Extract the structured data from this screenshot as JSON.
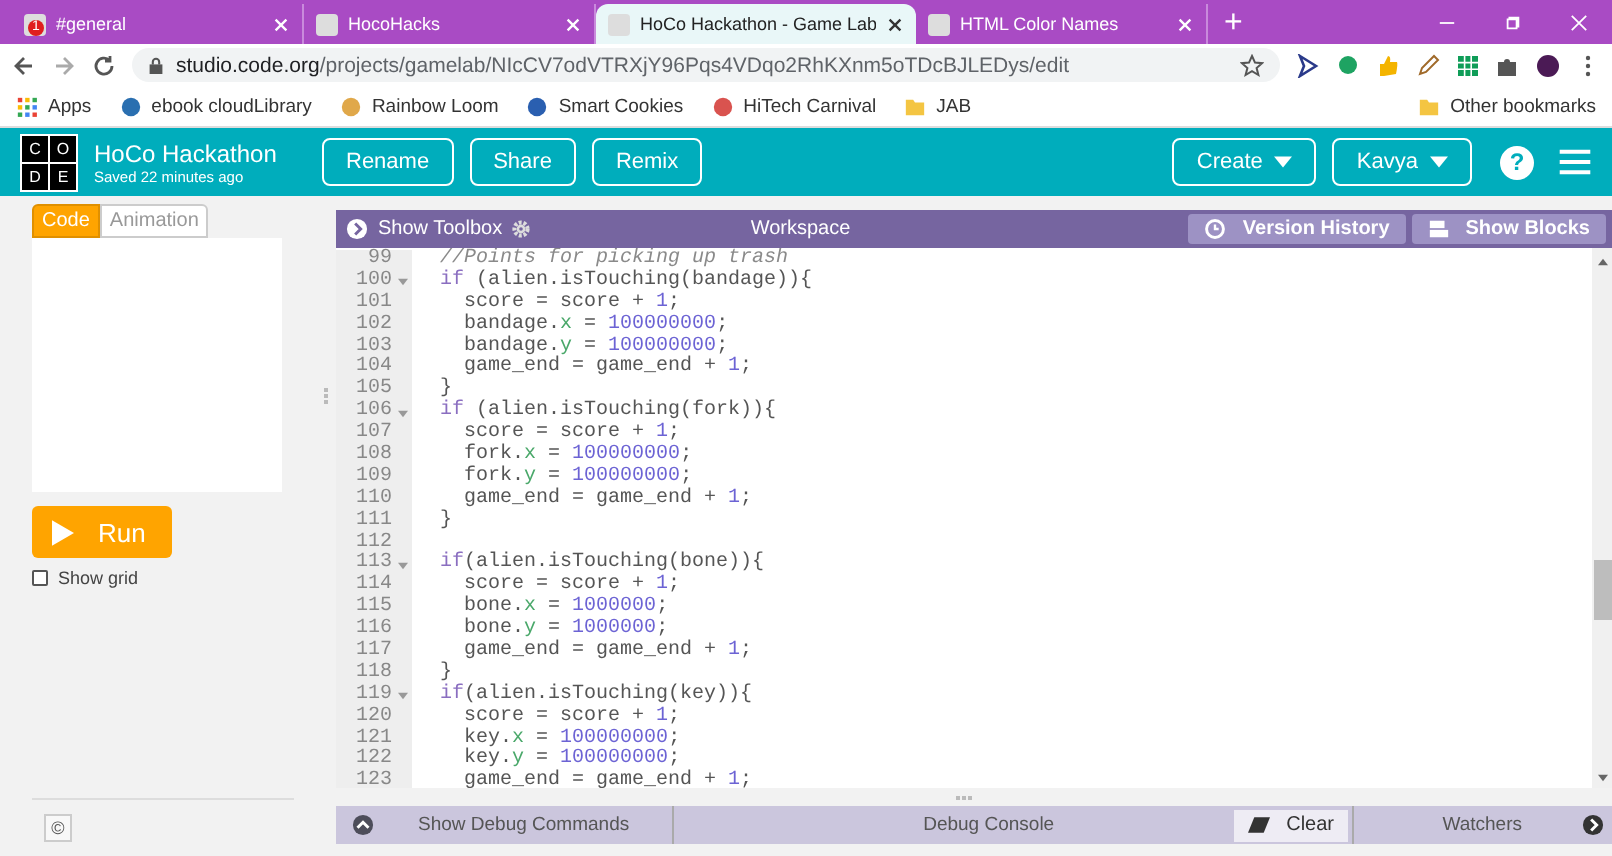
{
  "browser": {
    "tabs": [
      {
        "title": "#general",
        "selected": false,
        "badge": "1"
      },
      {
        "title": "HocoHacks",
        "selected": false
      },
      {
        "title": "HoCo Hackathon - Game Lab",
        "selected": true
      },
      {
        "title": "HTML Color Names",
        "selected": false
      }
    ],
    "new_tab": "+",
    "url_host": "studio.code.org",
    "url_path": "/projects/gamelab/NIcCV7odVTRXjY96Pqs4VDqo2RhKXnm5oTDcBJLEDys/edit",
    "bookmarks": [
      "Apps",
      "ebook cloudLibrary",
      "Rainbow Loom",
      "Smart Cookies",
      "HiTech Carnival",
      "JAB"
    ],
    "other_bookmarks": "Other bookmarks"
  },
  "header": {
    "logo": [
      "C",
      "O",
      "D",
      "E"
    ],
    "title": "HoCo Hackathon",
    "saved": "Saved 22 minutes ago",
    "buttons": [
      "Rename",
      "Share",
      "Remix"
    ],
    "create": "Create",
    "user": "Kavya",
    "help": "?"
  },
  "left": {
    "tabs": [
      {
        "label": "Code",
        "selected": true
      },
      {
        "label": "Animation",
        "selected": false
      }
    ],
    "run": "Run",
    "show_grid": {
      "label": "Show grid",
      "checked": false
    },
    "copyright": "©"
  },
  "workspace": {
    "toolbox": "Show Toolbox",
    "title": "Workspace",
    "version_history": "Version History",
    "show_blocks": "Show Blocks",
    "lines": [
      {
        "n": "99",
        "fold": false,
        "code": [
          {
            "kind": "comment",
            "text": "//Points for picking up trash"
          }
        ]
      },
      {
        "n": "100",
        "fold": true,
        "code": [
          {
            "kind": "keyword",
            "text": "if"
          },
          " (alien.isTouching(bandage)){"
        ]
      },
      {
        "n": "101",
        "fold": false,
        "code": [
          "  score = score + ",
          {
            "kind": "number",
            "text": "1"
          },
          ";"
        ]
      },
      {
        "n": "102",
        "fold": false,
        "code": [
          "  bandage.",
          {
            "kind": "property",
            "text": "x"
          },
          " = ",
          {
            "kind": "number",
            "text": "100000000"
          },
          ";"
        ]
      },
      {
        "n": "103",
        "fold": false,
        "code": [
          "  bandage.",
          {
            "kind": "property",
            "text": "y"
          },
          " = ",
          {
            "kind": "number",
            "text": "100000000"
          },
          ";"
        ]
      },
      {
        "n": "104",
        "fold": false,
        "code": [
          "  game_end = game_end + ",
          {
            "kind": "number",
            "text": "1"
          },
          ";"
        ]
      },
      {
        "n": "105",
        "fold": false,
        "code": [
          "}"
        ]
      },
      {
        "n": "106",
        "fold": true,
        "code": [
          {
            "kind": "keyword",
            "text": "if"
          },
          " (alien.isTouching(fork)){"
        ]
      },
      {
        "n": "107",
        "fold": false,
        "code": [
          "  score = score + ",
          {
            "kind": "number",
            "text": "1"
          },
          ";"
        ]
      },
      {
        "n": "108",
        "fold": false,
        "code": [
          "  fork.",
          {
            "kind": "property",
            "text": "x"
          },
          " = ",
          {
            "kind": "number",
            "text": "100000000"
          },
          ";"
        ]
      },
      {
        "n": "109",
        "fold": false,
        "code": [
          "  fork.",
          {
            "kind": "property",
            "text": "y"
          },
          " = ",
          {
            "kind": "number",
            "text": "100000000"
          },
          ";"
        ]
      },
      {
        "n": "110",
        "fold": false,
        "code": [
          "  game_end = game_end + ",
          {
            "kind": "number",
            "text": "1"
          },
          ";"
        ]
      },
      {
        "n": "111",
        "fold": false,
        "code": [
          "}"
        ]
      },
      {
        "n": "112",
        "fold": false
      },
      {
        "n": "113",
        "fold": true,
        "code": [
          {
            "kind": "keyword",
            "text": "if"
          },
          "(alien.isTouching(bone)){"
        ]
      },
      {
        "n": "114",
        "fold": false,
        "code": [
          "  score = score + ",
          {
            "kind": "number",
            "text": "1"
          },
          ";"
        ]
      },
      {
        "n": "115",
        "fold": false,
        "code": [
          "  bone.",
          {
            "kind": "property",
            "text": "x"
          },
          " = ",
          {
            "kind": "number",
            "text": "1000000"
          },
          ";"
        ]
      },
      {
        "n": "116",
        "fold": false,
        "code": [
          "  bone.",
          {
            "kind": "property",
            "text": "y"
          },
          " = ",
          {
            "kind": "number",
            "text": "1000000"
          },
          ";"
        ]
      },
      {
        "n": "117",
        "fold": false,
        "code": [
          "  game_end = game_end + ",
          {
            "kind": "number",
            "text": "1"
          },
          ";"
        ]
      },
      {
        "n": "118",
        "fold": false,
        "code": [
          "}"
        ]
      },
      {
        "n": "119",
        "fold": true,
        "code": [
          {
            "kind": "keyword",
            "text": "if"
          },
          "(alien.isTouching(key)){"
        ]
      },
      {
        "n": "120",
        "fold": false,
        "code": [
          "  score = score + ",
          {
            "kind": "number",
            "text": "1"
          },
          ";"
        ]
      },
      {
        "n": "121",
        "fold": false,
        "code": [
          "  key.",
          {
            "kind": "property",
            "text": "x"
          },
          " = ",
          {
            "kind": "number",
            "text": "100000000"
          },
          ";"
        ]
      },
      {
        "n": "122",
        "fold": false,
        "code": [
          "  key.",
          {
            "kind": "property",
            "text": "y"
          },
          " = ",
          {
            "kind": "number",
            "text": "100000000"
          },
          ";"
        ]
      },
      {
        "n": "123",
        "fold": false,
        "code": [
          "  game_end = game_end + ",
          {
            "kind": "number",
            "text": "1"
          },
          ";"
        ]
      }
    ]
  },
  "debug": {
    "commands": "Show Debug Commands",
    "console": "Debug Console",
    "clear": "Clear",
    "watchers": "Watchers"
  }
}
